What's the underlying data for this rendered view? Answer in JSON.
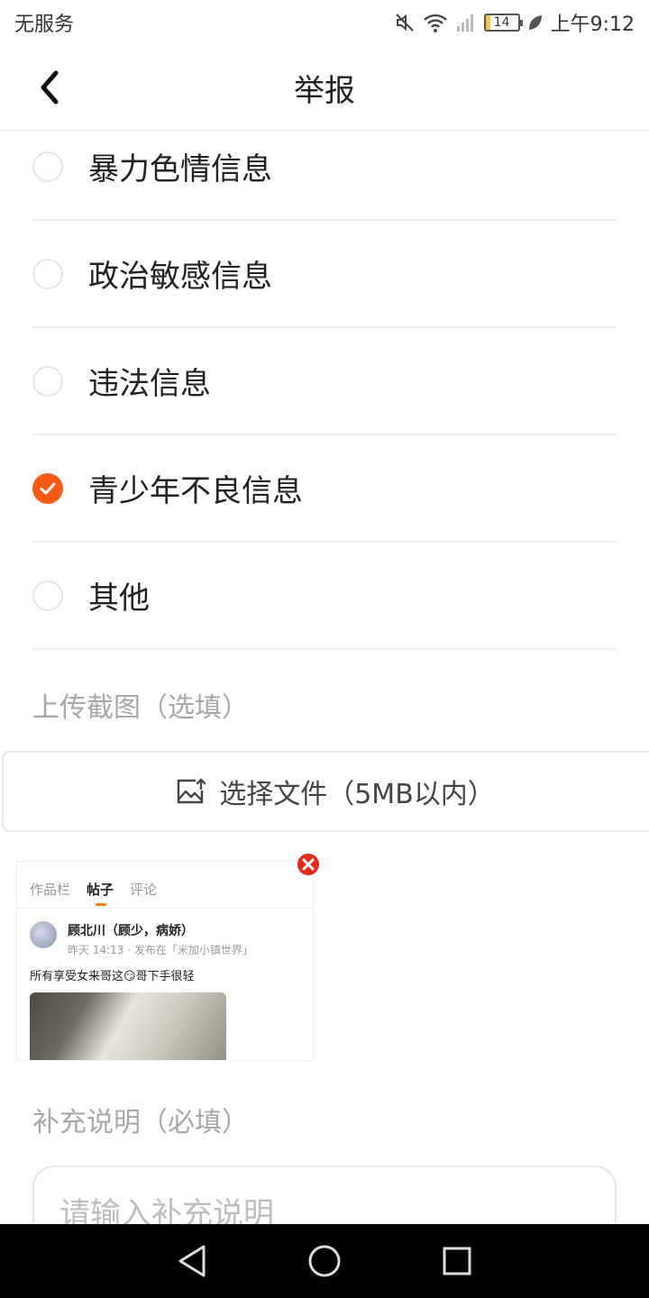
{
  "status_bar": {
    "carrier": "无服务",
    "battery_level": "14",
    "time": "上午9:12",
    "icons": [
      "mute-icon",
      "wifi-icon",
      "signal-icon",
      "battery-icon",
      "leaf-icon"
    ]
  },
  "header": {
    "title": "举报",
    "back_icon": "chevron-left-icon"
  },
  "report_options": [
    {
      "label": "暴力色情信息",
      "selected": false
    },
    {
      "label": "政治敏感信息",
      "selected": false
    },
    {
      "label": "违法信息",
      "selected": false
    },
    {
      "label": "青少年不良信息",
      "selected": true
    },
    {
      "label": "其他",
      "selected": false
    }
  ],
  "upload": {
    "section_label": "上传截图（选填）",
    "button_label": "选择文件（5MB以内）",
    "button_icon": "image-upload-icon"
  },
  "screenshot_preview": {
    "tabs": [
      "作品栏",
      "帖子",
      "评论"
    ],
    "active_tab": "帖子",
    "author": "顾北川（顾少，病娇）",
    "meta": "昨天 14:13 · 发布在「米加小镇世界」",
    "text": "所有享受女来哥这😏哥下手很轻",
    "remove_icon": "close-circle-icon"
  },
  "description": {
    "section_label": "补充说明（必填）",
    "placeholder": "请输入补充说明"
  },
  "nav_bar": {
    "icons": [
      "back-triangle-icon",
      "home-circle-icon",
      "recents-square-icon"
    ]
  },
  "colors": {
    "accent": "#f75a16",
    "divider": "#eeeeee",
    "muted_text": "#a8a8a8",
    "remove_red": "#e02a1e"
  }
}
